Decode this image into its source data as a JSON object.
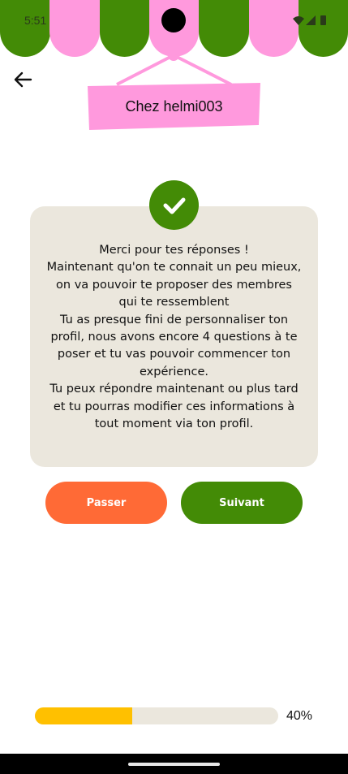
{
  "status_bar": {
    "time": "5:51",
    "icons": [
      "wifi-icon",
      "signal-icon",
      "battery-icon"
    ]
  },
  "colors": {
    "awning_green": "#438b06",
    "awning_pink": "#ff99dd",
    "card_bg": "#ebe7dd",
    "skip_button": "#ff6a36",
    "next_button": "#438b06",
    "progress_fill": "#ffc000"
  },
  "header": {
    "back_icon": "arrow-left-icon",
    "sign_title": "Chez helmi003"
  },
  "card": {
    "check_icon": "checkmark-icon",
    "lines": [
      "Merci pour tes réponses !",
      "Maintenant qu'on te connait un peu mieux,",
      "on va pouvoir te proposer des membres",
      "qui te ressemblent",
      "Tu as presque fini de personnaliser ton",
      "profil, nous avons encore 4 questions à te",
      "poser et tu vas pouvoir commencer ton",
      "expérience.",
      "Tu peux répondre maintenant ou plus tard",
      "et tu pourras modifier ces informations à",
      "tout moment via ton profil."
    ]
  },
  "actions": {
    "skip_label": "Passer",
    "next_label": "Suivant"
  },
  "progress": {
    "fraction": 0.4,
    "label": "40%"
  }
}
